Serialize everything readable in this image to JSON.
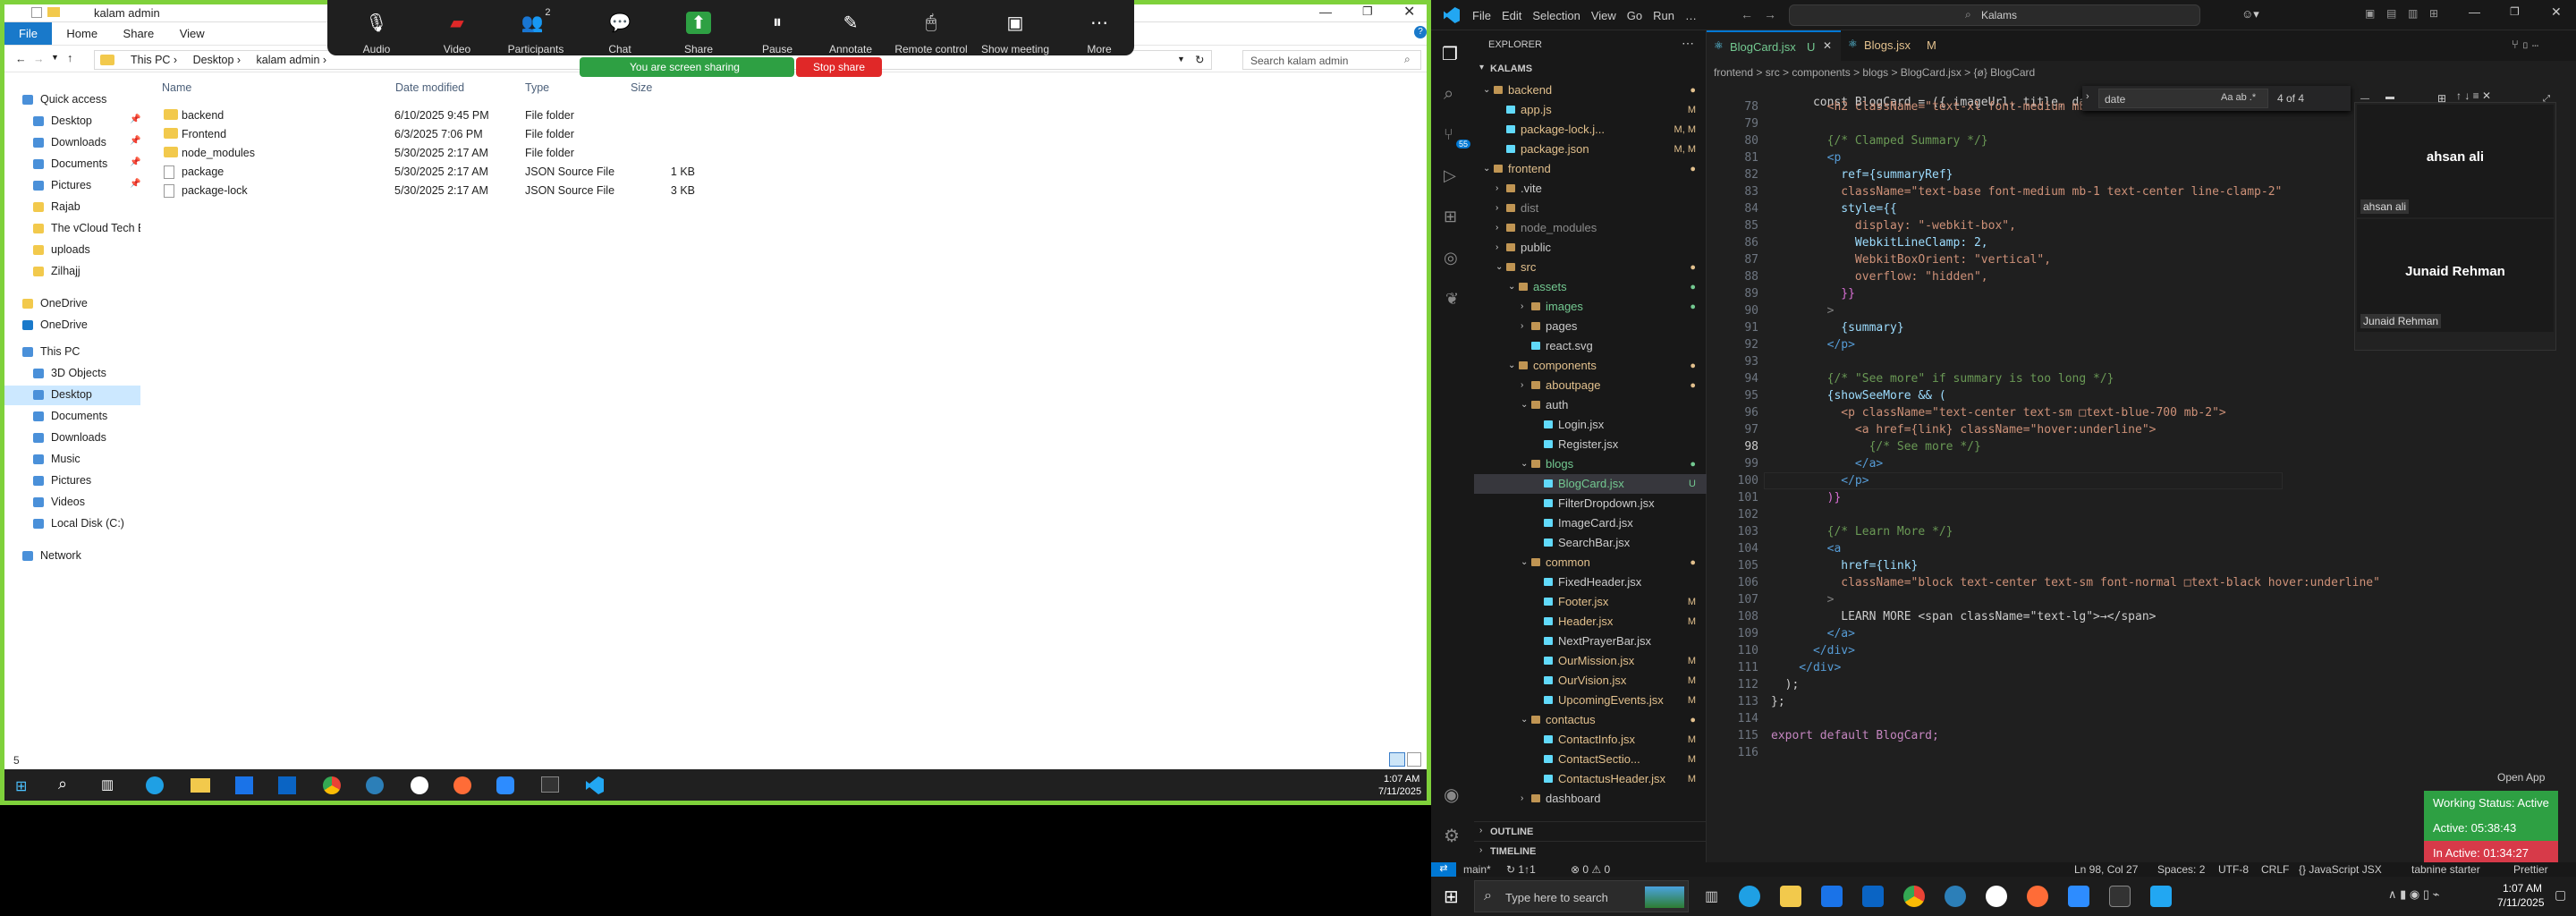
{
  "explorer": {
    "title": "kalam admin",
    "tabs": [
      "File",
      "Home",
      "Share",
      "View"
    ],
    "path": [
      "This PC",
      "Desktop",
      "kalam admin"
    ],
    "search_placeholder": "Search kalam admin",
    "columns": [
      "Name",
      "Date modified",
      "Type",
      "Size"
    ],
    "files": [
      {
        "name": "backend",
        "date": "6/10/2025 9:45 PM",
        "type": "File folder",
        "size": "",
        "icon": "folder-icon"
      },
      {
        "name": "Frontend",
        "date": "6/3/2025 7:06 PM",
        "type": "File folder",
        "size": "",
        "icon": "folder-icon"
      },
      {
        "name": "node_modules",
        "date": "5/30/2025 2:17 AM",
        "type": "File folder",
        "size": "",
        "icon": "folder-icon"
      },
      {
        "name": "package",
        "date": "5/30/2025 2:17 AM",
        "type": "JSON Source File",
        "size": "1 KB",
        "icon": "file-icon"
      },
      {
        "name": "package-lock",
        "date": "5/30/2025 2:17 AM",
        "type": "JSON Source File",
        "size": "3 KB",
        "icon": "file-icon"
      }
    ],
    "nav": [
      {
        "label": "Quick access",
        "indent": 0,
        "icon": "star-icon",
        "pin": false
      },
      {
        "label": "Desktop",
        "indent": 1,
        "icon": "desktop-icon",
        "pin": true
      },
      {
        "label": "Downloads",
        "indent": 1,
        "icon": "download-icon",
        "pin": true
      },
      {
        "label": "Documents",
        "indent": 1,
        "icon": "document-icon",
        "pin": true
      },
      {
        "label": "Pictures",
        "indent": 1,
        "icon": "picture-icon",
        "pin": true
      },
      {
        "label": "Rajab",
        "indent": 1,
        "icon": "folder-icon",
        "pin": false
      },
      {
        "label": "The vCloud Tech Bl",
        "indent": 1,
        "icon": "folder-icon",
        "pin": false
      },
      {
        "label": "uploads",
        "indent": 1,
        "icon": "folder-icon",
        "pin": false
      },
      {
        "label": "Zilhajj",
        "indent": 1,
        "icon": "folder-icon",
        "pin": false
      },
      {
        "label": "OneDrive",
        "indent": 0,
        "icon": "folder-icon",
        "pin": false
      },
      {
        "label": "OneDrive",
        "indent": 0,
        "icon": "cloud-icon",
        "pin": false
      },
      {
        "label": "This PC",
        "indent": 0,
        "icon": "pc-icon",
        "pin": false
      },
      {
        "label": "3D Objects",
        "indent": 1,
        "icon": "cube-icon",
        "pin": false
      },
      {
        "label": "Desktop",
        "indent": 1,
        "icon": "desktop-icon",
        "pin": false,
        "selected": true
      },
      {
        "label": "Documents",
        "indent": 1,
        "icon": "document-icon",
        "pin": false
      },
      {
        "label": "Downloads",
        "indent": 1,
        "icon": "download-icon",
        "pin": false
      },
      {
        "label": "Music",
        "indent": 1,
        "icon": "music-icon",
        "pin": false
      },
      {
        "label": "Pictures",
        "indent": 1,
        "icon": "picture-icon",
        "pin": false
      },
      {
        "label": "Videos",
        "indent": 1,
        "icon": "video-icon",
        "pin": false
      },
      {
        "label": "Local Disk (C:)",
        "indent": 1,
        "icon": "disk-icon",
        "pin": false
      },
      {
        "label": "Network",
        "indent": 0,
        "icon": "network-icon",
        "pin": false
      }
    ],
    "status": "5"
  },
  "zoom": {
    "buttons": [
      {
        "label": "Audio",
        "icon": "microphone-icon"
      },
      {
        "label": "Video",
        "icon": "video-off-icon"
      },
      {
        "label": "Participants",
        "icon": "participants-icon",
        "count": "2"
      },
      {
        "label": "Chat",
        "icon": "chat-icon"
      },
      {
        "label": "Share",
        "icon": "share-icon"
      },
      {
        "label": "Pause",
        "icon": "pause-icon"
      },
      {
        "label": "Annotate",
        "icon": "annotate-icon"
      },
      {
        "label": "Remote control",
        "icon": "remote-control-icon"
      },
      {
        "label": "Show meeting",
        "icon": "show-meeting-icon"
      },
      {
        "label": "More",
        "icon": "more-icon"
      }
    ],
    "sharing_text": "You are screen sharing",
    "stop_share": "Stop share",
    "participants": [
      "ahsan ali",
      "Junaid Rehman"
    ]
  },
  "taskbar_left": {
    "time": "1:07 AM",
    "date": "7/11/2025"
  },
  "vscode": {
    "menu": [
      "File",
      "Edit",
      "Selection",
      "View",
      "Go",
      "Run",
      "…"
    ],
    "search": "Kalams",
    "tabs": [
      {
        "label": "BlogCard.jsx",
        "badge": "U",
        "active": true
      },
      {
        "label": "Blogs.jsx",
        "badge": "M",
        "active": false
      }
    ],
    "breadcrumb": "frontend > src > components > blogs > BlogCard.jsx > {ø} BlogCard",
    "explorer_title": "EXPLORER",
    "root": "KALAMS",
    "tree": [
      {
        "label": "backend",
        "depth": 0,
        "type": "folder-open",
        "status": "",
        "color": "#e2c08d"
      },
      {
        "label": "app.js",
        "depth": 1,
        "type": "file",
        "status": "M",
        "color": "#e2c08d"
      },
      {
        "label": "package-lock.j...",
        "depth": 1,
        "type": "file",
        "status": "M, M",
        "color": "#e2c08d"
      },
      {
        "label": "package.json",
        "depth": 1,
        "type": "file",
        "status": "M, M",
        "color": "#e2c08d"
      },
      {
        "label": "frontend",
        "depth": 0,
        "type": "folder-open",
        "status": "",
        "color": "#e2c08d"
      },
      {
        "label": ".vite",
        "depth": 1,
        "type": "folder",
        "status": "",
        "color": "#ccc"
      },
      {
        "label": "dist",
        "depth": 1,
        "type": "folder",
        "status": "",
        "color": "#8b8b8b"
      },
      {
        "label": "node_modules",
        "depth": 1,
        "type": "folder",
        "status": "",
        "color": "#8b8b8b"
      },
      {
        "label": "public",
        "depth": 1,
        "type": "folder",
        "status": "",
        "color": "#ccc"
      },
      {
        "label": "src",
        "depth": 1,
        "type": "folder-open",
        "status": "",
        "color": "#e2c08d"
      },
      {
        "label": "assets",
        "depth": 2,
        "type": "folder-open",
        "status": "",
        "color": "#73c991"
      },
      {
        "label": "images",
        "depth": 3,
        "type": "folder",
        "status": "",
        "color": "#73c991"
      },
      {
        "label": "pages",
        "depth": 3,
        "type": "folder",
        "status": "",
        "color": "#ccc"
      },
      {
        "label": "react.svg",
        "depth": 3,
        "type": "file",
        "status": "",
        "color": "#ccc"
      },
      {
        "label": "components",
        "depth": 2,
        "type": "folder-open",
        "status": "",
        "color": "#e2c08d"
      },
      {
        "label": "aboutpage",
        "depth": 3,
        "type": "folder",
        "status": "",
        "color": "#e2c08d"
      },
      {
        "label": "auth",
        "depth": 3,
        "type": "folder-open",
        "status": "",
        "color": "#ccc"
      },
      {
        "label": "Login.jsx",
        "depth": 4,
        "type": "file",
        "status": "",
        "color": "#ccc"
      },
      {
        "label": "Register.jsx",
        "depth": 4,
        "type": "file",
        "status": "",
        "color": "#ccc"
      },
      {
        "label": "blogs",
        "depth": 3,
        "type": "folder-open",
        "status": "",
        "color": "#73c991"
      },
      {
        "label": "BlogCard.jsx",
        "depth": 4,
        "type": "file",
        "status": "U",
        "color": "#73c991",
        "selected": true
      },
      {
        "label": "FilterDropdown.jsx",
        "depth": 4,
        "type": "file",
        "status": "",
        "color": "#ccc"
      },
      {
        "label": "ImageCard.jsx",
        "depth": 4,
        "type": "file",
        "status": "",
        "color": "#ccc"
      },
      {
        "label": "SearchBar.jsx",
        "depth": 4,
        "type": "file",
        "status": "",
        "color": "#ccc"
      },
      {
        "label": "common",
        "depth": 3,
        "type": "folder-open",
        "status": "",
        "color": "#e2c08d"
      },
      {
        "label": "FixedHeader.jsx",
        "depth": 4,
        "type": "file",
        "status": "",
        "color": "#ccc"
      },
      {
        "label": "Footer.jsx",
        "depth": 4,
        "type": "file",
        "status": "M",
        "color": "#e2c08d"
      },
      {
        "label": "Header.jsx",
        "depth": 4,
        "type": "file",
        "status": "M",
        "color": "#e2c08d"
      },
      {
        "label": "NextPrayerBar.jsx",
        "depth": 4,
        "type": "file",
        "status": "",
        "color": "#ccc"
      },
      {
        "label": "OurMission.jsx",
        "depth": 4,
        "type": "file",
        "status": "M",
        "color": "#e2c08d"
      },
      {
        "label": "OurVision.jsx",
        "depth": 4,
        "type": "file",
        "status": "M",
        "color": "#e2c08d"
      },
      {
        "label": "UpcomingEvents.jsx",
        "depth": 4,
        "type": "file",
        "status": "M",
        "color": "#e2c08d"
      },
      {
        "label": "contactus",
        "depth": 3,
        "type": "folder-open",
        "status": "",
        "color": "#e2c08d"
      },
      {
        "label": "ContactInfo.jsx",
        "depth": 4,
        "type": "file",
        "status": "M",
        "color": "#e2c08d"
      },
      {
        "label": "ContactSectio...",
        "depth": 4,
        "type": "file",
        "status": "M",
        "color": "#e2c08d"
      },
      {
        "label": "ContactusHeader.jsx",
        "depth": 4,
        "type": "file",
        "status": "M",
        "color": "#e2c08d"
      },
      {
        "label": "dashboard",
        "depth": 3,
        "type": "folder",
        "status": "",
        "color": "#ccc"
      }
    ],
    "outline": "OUTLINE",
    "timeline": "TIMELINE",
    "find": {
      "value": "date",
      "count": "4 of 4"
    },
    "code": [
      {
        "n": "78",
        "t": "        <h2 className=\"text-xl font-medium mb-3 text",
        "c": "#ce9178"
      },
      {
        "n": "79",
        "t": "",
        "c": "#ccc"
      },
      {
        "n": "80",
        "t": "        {/* Clamped Summary */}",
        "c": "#6a9955"
      },
      {
        "n": "81",
        "t": "        <p",
        "c": "#569cd6"
      },
      {
        "n": "82",
        "t": "          ref={summaryRef}",
        "c": "#9cdcfe"
      },
      {
        "n": "83",
        "t": "          className=\"text-base font-medium mb-1 text-center line-clamp-2\"",
        "c": "#ce9178"
      },
      {
        "n": "84",
        "t": "          style={{",
        "c": "#9cdcfe"
      },
      {
        "n": "85",
        "t": "            display: \"-webkit-box\",",
        "c": "#ce9178"
      },
      {
        "n": "86",
        "t": "            WebkitLineClamp: 2,",
        "c": "#9cdcfe"
      },
      {
        "n": "87",
        "t": "            WebkitBoxOrient: \"vertical\",",
        "c": "#ce9178"
      },
      {
        "n": "88",
        "t": "            overflow: \"hidden\",",
        "c": "#ce9178"
      },
      {
        "n": "89",
        "t": "          }}",
        "c": "#da70d6"
      },
      {
        "n": "90",
        "t": "        >",
        "c": "#808080"
      },
      {
        "n": "91",
        "t": "          {summary}",
        "c": "#9cdcfe"
      },
      {
        "n": "92",
        "t": "        </p>",
        "c": "#569cd6"
      },
      {
        "n": "93",
        "t": "",
        "c": "#ccc"
      },
      {
        "n": "94",
        "t": "        {/* \"See more\" if summary is too long */}",
        "c": "#6a9955"
      },
      {
        "n": "95",
        "t": "        {showSeeMore && (",
        "c": "#9cdcfe"
      },
      {
        "n": "96",
        "t": "          <p className=\"text-center text-sm □text-blue-700 mb-2\">",
        "c": "#ce9178"
      },
      {
        "n": "97",
        "t": "            <a href={link} className=\"hover:underline\">",
        "c": "#ce9178"
      },
      {
        "n": "98",
        "t": "              {/* See more */}",
        "c": "#6a9955"
      },
      {
        "n": "99",
        "t": "            </a>",
        "c": "#569cd6"
      },
      {
        "n": "100",
        "t": "          </p>",
        "c": "#569cd6"
      },
      {
        "n": "101",
        "t": "        )}",
        "c": "#da70d6"
      },
      {
        "n": "102",
        "t": "",
        "c": "#ccc"
      },
      {
        "n": "103",
        "t": "        {/* Learn More */}",
        "c": "#6a9955"
      },
      {
        "n": "104",
        "t": "        <a",
        "c": "#569cd6"
      },
      {
        "n": "105",
        "t": "          href={link}",
        "c": "#9cdcfe"
      },
      {
        "n": "106",
        "t": "          className=\"block text-center text-sm font-normal □text-black hover:underline\"",
        "c": "#ce9178"
      },
      {
        "n": "107",
        "t": "        >",
        "c": "#808080"
      },
      {
        "n": "108",
        "t": "          LEARN MORE <span className=\"text-lg\">→</span>",
        "c": "#ccc"
      },
      {
        "n": "109",
        "t": "        </a>",
        "c": "#569cd6"
      },
      {
        "n": "110",
        "t": "      </div>",
        "c": "#569cd6"
      },
      {
        "n": "111",
        "t": "    </div>",
        "c": "#569cd6"
      },
      {
        "n": "112",
        "t": "  );",
        "c": "#ccc"
      },
      {
        "n": "113",
        "t": "};",
        "c": "#ccc"
      },
      {
        "n": "114",
        "t": "",
        "c": "#ccc"
      },
      {
        "n": "115",
        "t": "export default BlogCard;",
        "c": "#c586c0"
      },
      {
        "n": "116",
        "t": "",
        "c": "#ccc"
      }
    ],
    "code_first_line": "const BlogCard = ({ imageUrl, title, date, category",
    "status_left": [
      "main*",
      "↻ 1↑1",
      "⊗ 0 ⚠ 0"
    ],
    "status_right": [
      "Ln 98, Col 27",
      "Spaces: 2",
      "UTF-8",
      "CRLF",
      "{} JavaScript JSX",
      "tabnine starter",
      "Prettier"
    ],
    "open_app": "Open App",
    "work": [
      {
        "label": "Working Status: Active",
        "color": "#2ea043"
      },
      {
        "label": "Active: 05:38:43",
        "color": "#2ea043"
      },
      {
        "label": "In Active: 01:34:27",
        "color": "#d73a49"
      }
    ]
  },
  "taskbar": {
    "search_placeholder": "Type here to search",
    "time": "1:07 AM",
    "date": "7/11/2025"
  }
}
